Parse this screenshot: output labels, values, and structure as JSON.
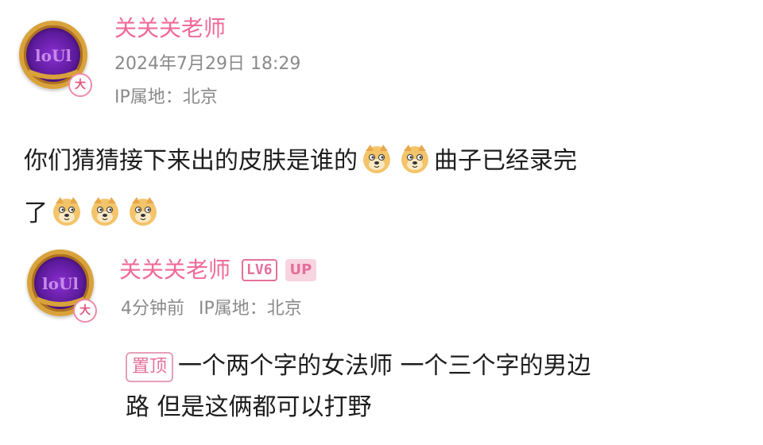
{
  "post": {
    "author": "关关关老师",
    "date": "2024年7月29日 18:29",
    "ip": "IP属地：北京",
    "avatar_badge": "大",
    "content_line1": "你们猜猜接下来出的皮肤是谁的",
    "content_line1b": "曲子已经录完",
    "content_line2": "了",
    "emoji_name": "doge-emoji"
  },
  "reply": {
    "author": "关关关老师",
    "level": "LV6",
    "up_tag": "UP",
    "time": "4分钟前",
    "ip": "IP属地：北京",
    "avatar_badge": "大",
    "pin_tag": "置顶",
    "content_line1": "一个两个字的女法师 一个三个字的男边",
    "content_line2": "路 但是这俩都可以打野"
  },
  "colors": {
    "name": "#f06a98",
    "meta": "#8a8a8a",
    "avatar_ring": "#d9a23a",
    "avatar_inner": "#6a1fb0"
  }
}
